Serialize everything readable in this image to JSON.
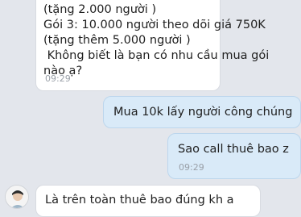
{
  "messages": {
    "in_1": {
      "lines": [
        "(tặng 2.000 người )",
        "Gói 3: 10.000 người theo dõi giá 750K",
        "(tặng thêm 5.000 người )",
        " Không biết là bạn có nhu cầu mua gói",
        "nào ạ?"
      ],
      "time": "09:29"
    },
    "out_1": {
      "text": "Mua 10k lấy người công chúng"
    },
    "out_2": {
      "text": "Sao call thuê bao z",
      "time": "09:29"
    },
    "in_2": {
      "text": "Là trên toàn thuê bao đúng kh a"
    }
  },
  "colors": {
    "background": "#e3e6ec",
    "incoming_bubble": "#ffffff",
    "outgoing_bubble": "#d9eaf8",
    "timestamp": "#9aa0a8"
  },
  "icons": {
    "contact_avatar": "avatar-icon"
  }
}
